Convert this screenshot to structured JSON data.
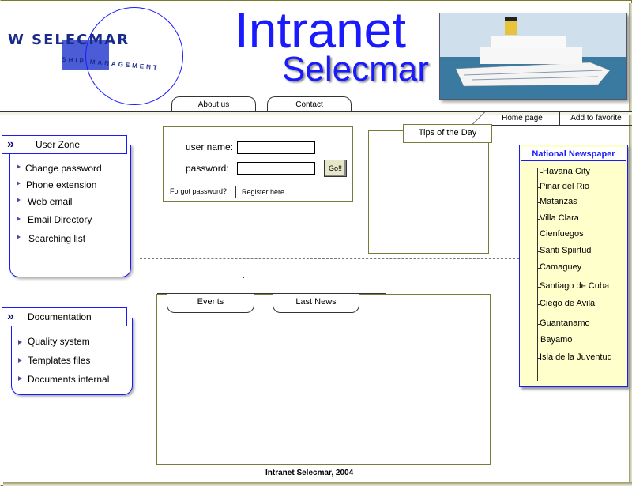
{
  "header": {
    "logo_text": "W SELECMAR",
    "logo_sub": "SHIP MANAGEMENT",
    "title_main": "Intranet",
    "title_sub": "Selecmar"
  },
  "top_tabs": [
    {
      "label": "About us"
    },
    {
      "label": "Contact"
    }
  ],
  "top_nav": [
    {
      "label": "Home page"
    },
    {
      "label": "Add to favorite"
    }
  ],
  "user_zone": {
    "title": "User Zone",
    "items": [
      {
        "label": "Change password"
      },
      {
        "label": "Phone extension"
      },
      {
        "label": "Web email"
      },
      {
        "label": "Email Directory"
      },
      {
        "label": "Searching list"
      }
    ]
  },
  "documentation": {
    "title": "Documentation",
    "items": [
      {
        "label": "Quality system"
      },
      {
        "label": "Templates files"
      },
      {
        "label": "Documents internal"
      }
    ]
  },
  "login": {
    "username_label": "user name:",
    "password_label": "password:",
    "username_value": "",
    "password_value": "",
    "go_label": "Go!!",
    "forgot_label": "Forgot password?",
    "register_label": "Register here"
  },
  "tips": {
    "title": "Tips of the Day"
  },
  "newspaper": {
    "title": "National Newspaper",
    "items": [
      {
        "label": "Havana City"
      },
      {
        "label": "Pinar del Rio"
      },
      {
        "label": "Matanzas"
      },
      {
        "label": "Villa Clara"
      },
      {
        "label": "Cienfuegos"
      },
      {
        "label": "Santi Spiirtud"
      },
      {
        "label": "Camaguey"
      },
      {
        "label": "Santiago de Cuba"
      },
      {
        "label": "Ciego de Avila"
      },
      {
        "label": "Guantanamo"
      },
      {
        "label": "Bayamo"
      },
      {
        "label": "Isla de la Juventud"
      }
    ]
  },
  "events_tabs": [
    {
      "label": "Events"
    },
    {
      "label": "Last News"
    }
  ],
  "footer": {
    "text": "Intranet Selecmar, 2004"
  },
  "colors": {
    "brand_blue": "#1a1aff",
    "panel_yellow": "#ffffcc",
    "frame_olive": "#7a7a3a"
  }
}
